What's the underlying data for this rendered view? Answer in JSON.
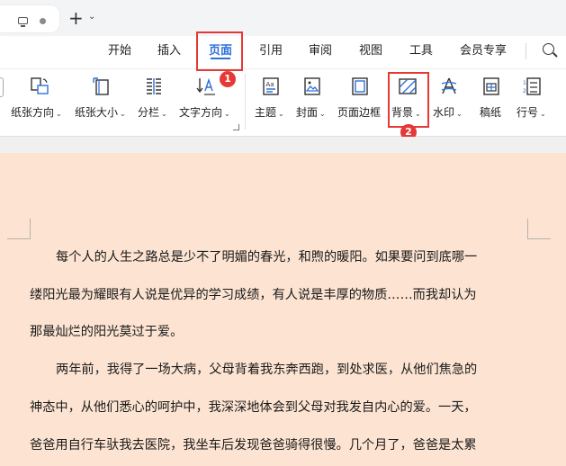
{
  "colors": {
    "accent": "#2f6fdc",
    "highlight": "#e53935",
    "doc_background": "#fde4d2"
  },
  "tabbar": {
    "doc_tab_icons": [
      "monitor-icon",
      "dot-icon"
    ],
    "new_tab_symbol": "+",
    "tab_menu_symbol": "⌄"
  },
  "menu": {
    "items": [
      "开始",
      "插入",
      "页面",
      "引用",
      "审阅",
      "视图",
      "工具",
      "会员专享"
    ],
    "active": "页面",
    "search_icon": "search-icon"
  },
  "ribbon": {
    "tools": [
      {
        "label": "纸张方向",
        "icon": "paper-orientation-icon"
      },
      {
        "label": "纸张大小",
        "icon": "paper-size-icon"
      },
      {
        "label": "分栏",
        "icon": "columns-icon"
      },
      {
        "label": "文字方向",
        "icon": "text-direction-icon"
      },
      {
        "label": "主题",
        "icon": "theme-icon"
      },
      {
        "label": "封面",
        "icon": "cover-icon"
      },
      {
        "label": "页面边框",
        "icon": "page-border-icon"
      },
      {
        "label": "背景",
        "icon": "background-icon"
      },
      {
        "label": "水印",
        "icon": "watermark-icon"
      },
      {
        "label": "稿纸",
        "icon": "manuscript-paper-icon"
      },
      {
        "label": "行号",
        "icon": "line-number-icon"
      }
    ],
    "dropdown_symbol": "⌄"
  },
  "callouts": {
    "step1": "1",
    "step2": "2"
  },
  "document": {
    "lines": [
      "每个人的人生之路总是少不了明媚的春光，和煦的暖阳。如果要问到底哪一",
      "缕阳光最为耀眼有人说是优异的学习成绩，有人说是丰厚的物质……而我却认为",
      "那最灿烂的阳光莫过于爱。",
      "两年前，我得了一场大病，父母背着我东奔西跑，到处求医，从他们焦急的",
      "神态中，从他们悉心的呵护中，我深深地体会到父母对我发自内心的爱。一天，",
      "爸爸用自行车驮我去医院，我坐车后发现爸爸骑得很慢。几个月了，爸爸是太累"
    ]
  }
}
